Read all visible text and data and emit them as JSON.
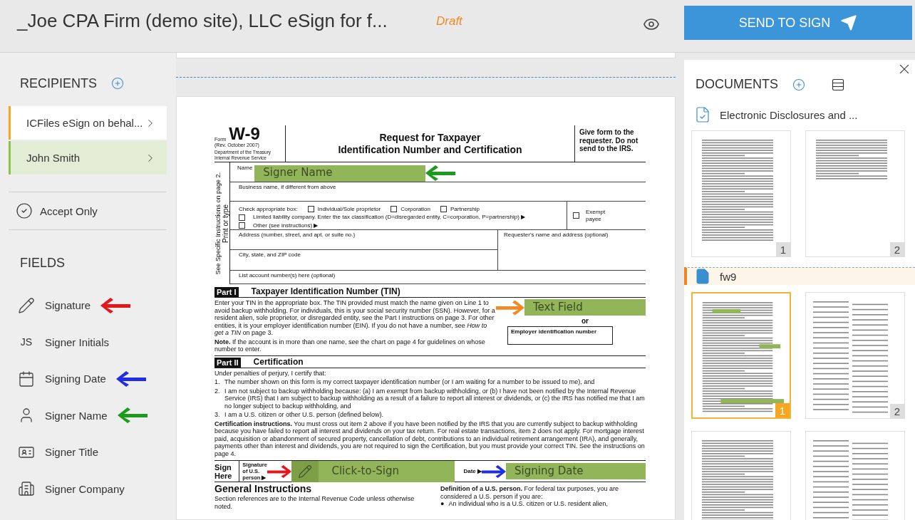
{
  "header": {
    "title": "_Joe CPA Firm (demo site), LLC eSign for f...",
    "status": "Draft",
    "send_button": "SEND TO SIGN"
  },
  "sidebar": {
    "recipients_title": "RECIPIENTS",
    "recipients": [
      {
        "name": "ICFiles eSign on behal...",
        "color": "#f5a623",
        "selected": false
      },
      {
        "name": "John Smith",
        "color": "#8bc34a",
        "selected": true
      }
    ],
    "accept_only": "Accept Only",
    "fields_title": "FIELDS",
    "fields": [
      {
        "kind": "signature",
        "label": "Signature",
        "color": "#e8141b"
      },
      {
        "kind": "initials",
        "icon_text": "JS",
        "label": "Signer Initials"
      },
      {
        "kind": "date",
        "label": "Signing Date",
        "color": "#1f2ee0"
      },
      {
        "kind": "name",
        "label": "Signer Name",
        "color": "#1b9a1b"
      },
      {
        "kind": "title",
        "label": "Signer Title"
      },
      {
        "kind": "company",
        "label": "Signer Company"
      }
    ]
  },
  "document": {
    "form_label": "Form",
    "form_number": "W-9",
    "revision": "(Rev. October 2007)",
    "department": "Department of the Treasury",
    "service": "Internal Revenue Service",
    "title_lines": [
      "Request for Taxpayer",
      "Identification Number and Certification"
    ],
    "give_form": "Give form to the requester. Do not send to the IRS.",
    "side_labels": [
      "Print or type",
      "See Specific Instructions on page 2."
    ],
    "name_label": "Name",
    "business_label": "Business name, if different from above",
    "check_label": "Check appropriate box:",
    "checkboxes": [
      {
        "label": "Individual/Sole proprietor",
        "checked": false
      },
      {
        "label": "Corporation",
        "checked": false
      },
      {
        "label": "Partnership",
        "checked": false
      }
    ],
    "llc": {
      "label": "Limited liability company. Enter the tax classification (D=disregarded entity, C=corporation, P=partnership) ▶",
      "checked": false
    },
    "other": {
      "label": "Other (see instructions) ▶",
      "checked": false
    },
    "exempt": {
      "label": "Exempt payee",
      "checked": false
    },
    "address_label": "Address (number, street, and apt. or suite no.)",
    "city_label": "City, state, and ZIP code",
    "requester_label": "Requester's name and address (optional)",
    "account_label": "List account number(s) here (optional)",
    "part1": {
      "tag": "Part I",
      "title": "Taxpayer Identification Number (TIN)"
    },
    "part1_text": "Enter your TIN in the appropriate box. The TIN provided must match the name given on Line 1 to avoid backup withholding. For individuals, this is your social security number (SSN). However, for a resident alien, sole proprietor, or disregarded entity, see the Part I instructions on page 3. For other entities, it is your employer identification number (EIN). If you do not have a number, see *How to get a TIN* on page 3.",
    "part1_note": "**Note.** If the account is in more than one name, see the chart on page 4 for guidelines on whose number to enter.",
    "or_label": "or",
    "ein_label": "Employer identification number",
    "part2": {
      "tag": "Part II",
      "title": "Certification"
    },
    "cert_intro": "Under penalties of perjury, I certify that:",
    "cert_items": [
      {
        "number": "1.",
        "text": "The number shown on this form is my correct taxpayer identification number (or I am waiting for a number to be issued to me), and"
      },
      {
        "number": "2.",
        "text": "I am not subject to backup withholding because: (a) I am exempt from backup withholding, or (b) I have not been notified by the Internal Revenue Service (IRS) that I am subject to backup withholding as a result of a failure to report all interest or dividends, or (c) the IRS has notified me that I am no longer subject to backup withholding, and"
      },
      {
        "number": "3.",
        "text": "I am a U.S. citizen or other U.S. person (defined below)."
      }
    ],
    "cert_instructions": "**Certification instructions.** You must cross out item 2 above if you have been notified by the IRS that you are currently subject to backup withholding because you have failed to report all interest and dividends on your tax return. For real estate transactions, item 2 does not apply. For mortgage interest paid, acquisition or abandonment of secured property, cancellation of debt, contributions to an individual retirement arrangement (IRA), and generally, payments other than interest and dividends, you are not required to sign the Certification, but you must provide your correct TIN. See the instructions on page 4.",
    "sign_here": "Sign Here",
    "signature_label": "Signature of U.S. person ▶",
    "date_label": "Date ▶",
    "general_title": "General Instructions",
    "general_text": "Section references are to the Internal Revenue Code unless otherwise noted.",
    "definition": "**Definition of a U.S. person.** For federal tax purposes, you are considered a U.S. person if you are:",
    "bullet_mark": "●",
    "bullet": "An individual who is a U.S. citizen or U.S. resident alien,",
    "placed_fields": [
      {
        "kind": "name",
        "label": "Signer Name",
        "color": "#1b9a1b"
      },
      {
        "kind": "text",
        "label": "Text Field",
        "color": "#f08a24"
      },
      {
        "kind": "signature",
        "label": "Click-to-Sign",
        "color": "#e8141b"
      },
      {
        "kind": "date",
        "label": "Signing Date",
        "color": "#1f2ee0"
      }
    ]
  },
  "documents_panel": {
    "title": "DOCUMENTS",
    "documents": [
      {
        "kind": "disclosure",
        "name": "Electronic Disclosures and ...",
        "selected": false,
        "pages": [
          {
            "number": "1",
            "selected": false
          },
          {
            "number": "2",
            "selected": false
          }
        ]
      },
      {
        "kind": "form",
        "name": "fw9",
        "selected": true,
        "pages": [
          {
            "number": "1",
            "selected": true
          },
          {
            "number": "2",
            "selected": false
          },
          {
            "selected": false
          },
          {
            "selected": false
          }
        ]
      }
    ]
  }
}
